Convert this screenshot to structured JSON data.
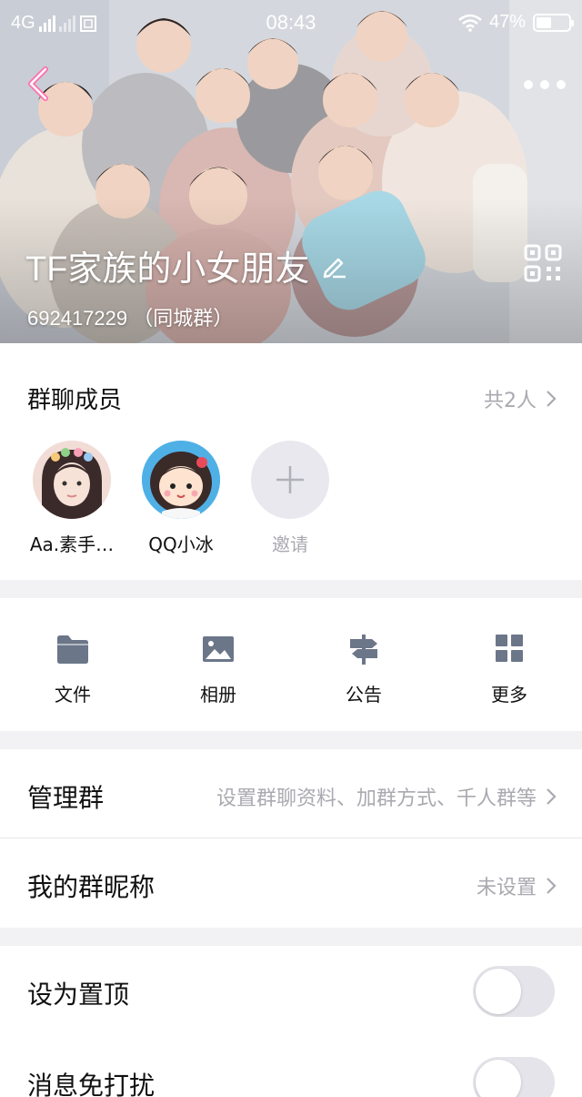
{
  "status_bar": {
    "network": "4G",
    "time": "08:43",
    "battery": "47%",
    "battery_level": 0.47
  },
  "header": {
    "group_name": "TF家族的小女朋友",
    "group_id": "692417229",
    "group_type": "（同城群）",
    "icons": [
      "back-chevron-icon",
      "more-dots-icon",
      "edit-pencil-icon",
      "qr-code-icon"
    ]
  },
  "members": {
    "title": "群聊成员",
    "count_label": "共2人",
    "list": [
      {
        "name": "Aa.素手…",
        "avatar": "girl-photo"
      },
      {
        "name": "QQ小冰",
        "avatar": "cartoon-girl"
      }
    ],
    "invite_label": "邀请"
  },
  "tools": [
    {
      "label": "文件",
      "icon": "folder-icon"
    },
    {
      "label": "相册",
      "icon": "image-icon"
    },
    {
      "label": "公告",
      "icon": "signpost-icon"
    },
    {
      "label": "更多",
      "icon": "grid-icon"
    }
  ],
  "manage": {
    "label": "管理群",
    "hint": "设置群聊资料、加群方式、千人群等"
  },
  "nickname": {
    "label": "我的群昵称",
    "value": "未设置"
  },
  "settings": {
    "pin_label": "设为置顶",
    "pin_on": false,
    "mute_label": "消息免打扰",
    "mute_on": false
  },
  "colors": {
    "icon_gray": "#6b7689",
    "secondary_text": "#a9a9b0",
    "back_chevron": "#ff6fb0"
  }
}
